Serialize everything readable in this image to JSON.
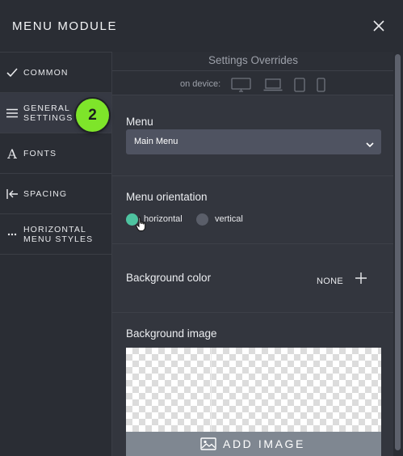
{
  "header": {
    "title": "MENU MODULE",
    "close_icon": "close-icon"
  },
  "sidebar": {
    "items": [
      {
        "label_lines": [
          "COMMON"
        ],
        "icon": "check-icon"
      },
      {
        "label_lines": [
          "GENERAL",
          "SETTINGS"
        ],
        "icon": "hamburger-icon",
        "active": true
      },
      {
        "label_lines": [
          "FONTS"
        ],
        "icon": "font-icon",
        "glyph": "A"
      },
      {
        "label_lines": [
          "SPACING"
        ],
        "icon": "arrow-left-bar-icon"
      },
      {
        "label_lines": [
          "HORIZONTAL",
          "MENU STYLES"
        ],
        "icon": "ellipsis-icon"
      }
    ],
    "step_badge": "2"
  },
  "overrides": {
    "title": "Settings Overrides",
    "device_label": "on device:",
    "devices": [
      "desktop-icon",
      "laptop-icon",
      "tablet-icon",
      "phone-icon"
    ]
  },
  "menu_section": {
    "title": "Menu",
    "selected": "Main Menu"
  },
  "orientation_section": {
    "title": "Menu orientation",
    "options": [
      {
        "label": "horizontal",
        "selected": true
      },
      {
        "label": "vertical",
        "selected": false
      }
    ],
    "selected_color": "#4ec3a0",
    "unselected_color": "#5a5e69"
  },
  "bgcolor_section": {
    "title": "Background color",
    "value": "NONE"
  },
  "bgimage_section": {
    "title": "Background image",
    "button_label": "ADD IMAGE"
  },
  "colors": {
    "badge": "#7ee52a",
    "panel": "#33363e",
    "sidebar": "#2a2d34",
    "add_image_bar": "#7f8791"
  }
}
